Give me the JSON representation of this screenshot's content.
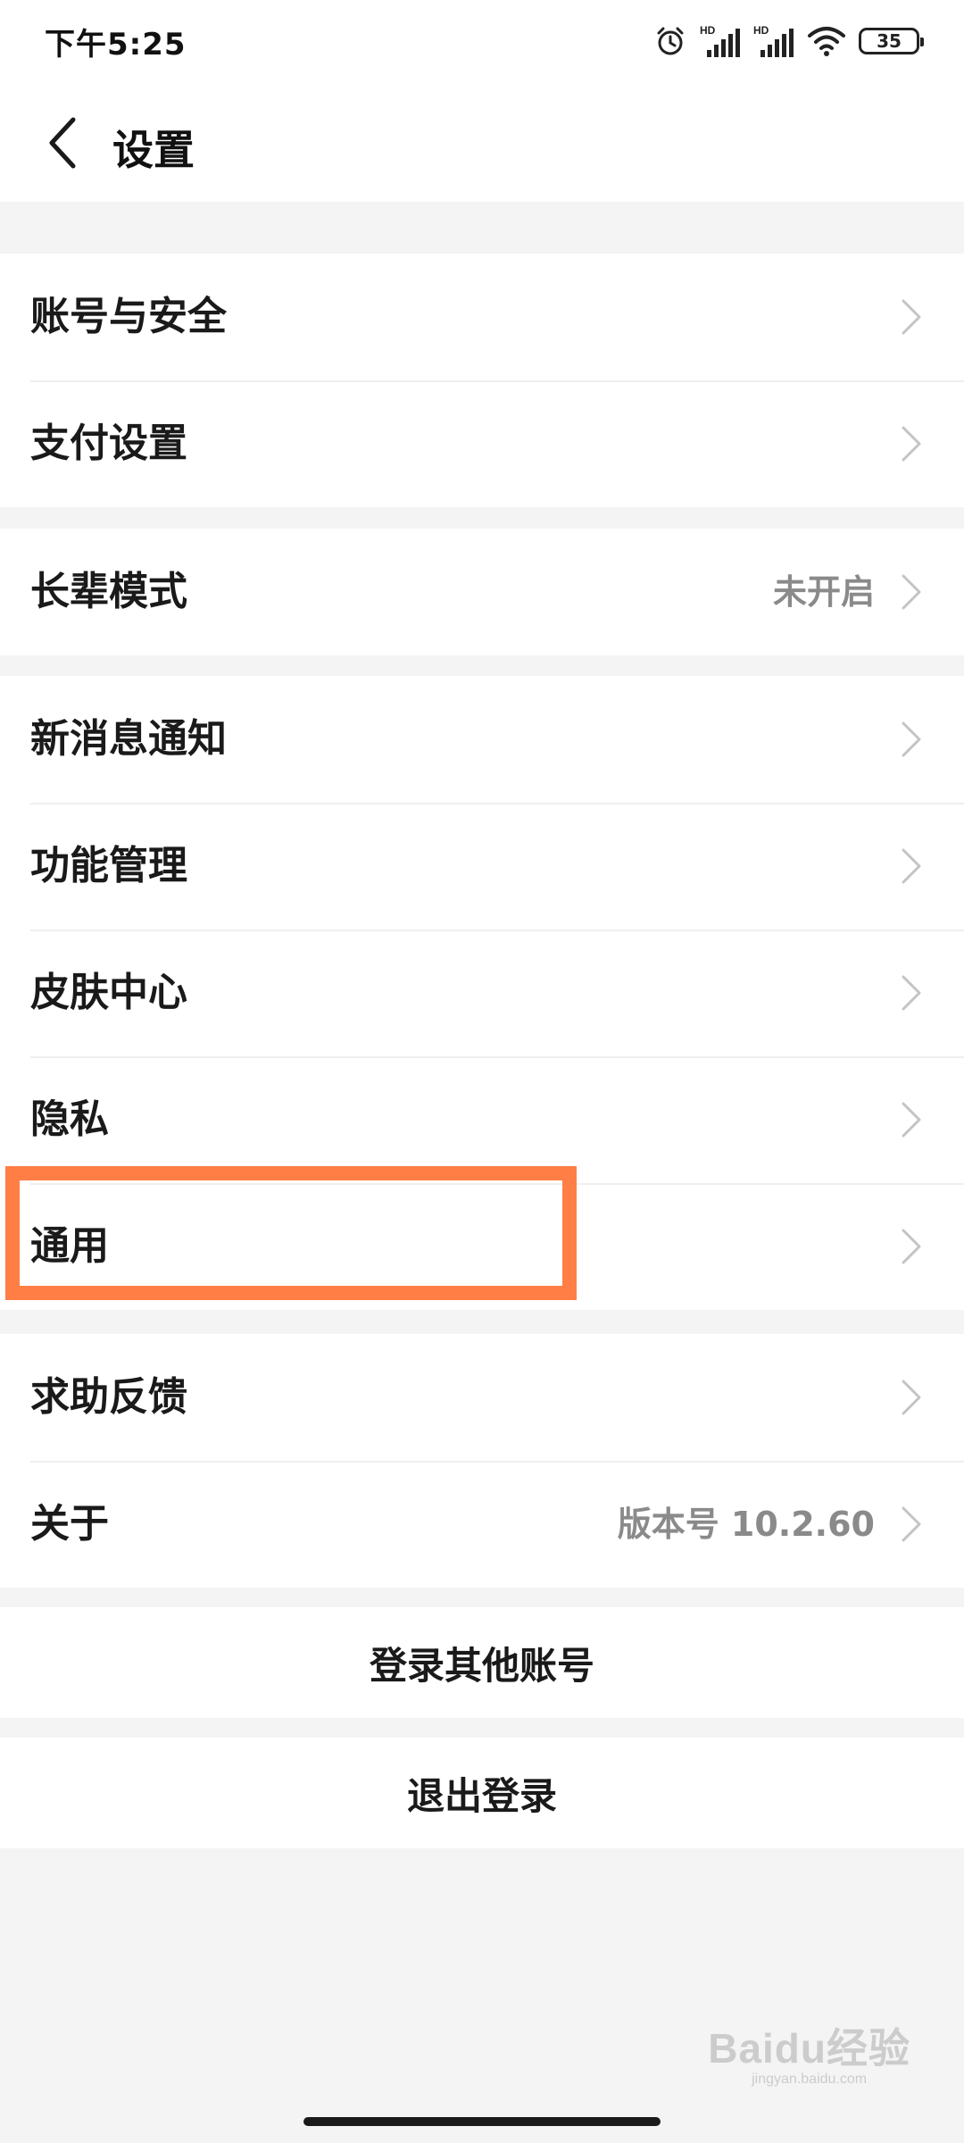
{
  "status_bar": {
    "time": "下午5:25",
    "battery": "35",
    "icons": [
      "alarm-icon",
      "signal-hd-icon",
      "signal-hd-icon",
      "wifi-icon",
      "battery-icon"
    ]
  },
  "header": {
    "title": "设置",
    "back_icon": "chevron-left-icon"
  },
  "groups": [
    {
      "items": [
        {
          "label": "账号与安全",
          "value": ""
        },
        {
          "label": "支付设置",
          "value": ""
        }
      ]
    },
    {
      "items": [
        {
          "label": "长辈模式",
          "value": "未开启"
        }
      ]
    },
    {
      "items": [
        {
          "label": "新消息通知",
          "value": ""
        },
        {
          "label": "功能管理",
          "value": ""
        },
        {
          "label": "皮肤中心",
          "value": ""
        },
        {
          "label": "隐私",
          "value": ""
        },
        {
          "label": "通用",
          "value": ""
        }
      ]
    },
    {
      "items": [
        {
          "label": "求助反馈",
          "value": ""
        },
        {
          "label": "关于",
          "value": "版本号 10.2.60"
        }
      ]
    }
  ],
  "actions": {
    "switch_account": "登录其他账号",
    "logout": "退出登录"
  },
  "highlight": {
    "color": "#ff7e45",
    "target": "通用"
  },
  "watermark": {
    "logo": "Baidu经验",
    "url": "jingyan.baidu.com"
  },
  "colors": {
    "background": "#f4f4f4",
    "card": "#ffffff",
    "text": "#1a1a1a",
    "secondary_text": "#8a8a8a",
    "chevron": "#c4c4c4"
  }
}
